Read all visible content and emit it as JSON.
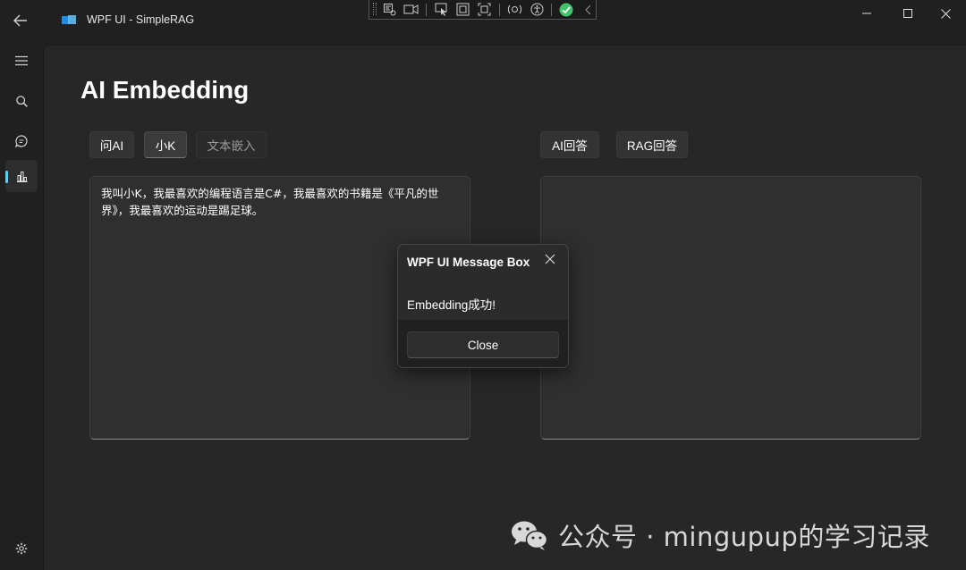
{
  "window": {
    "title": "WPF UI - SimpleRAG",
    "accent_color": "#60cdff"
  },
  "titlebar_icons": [
    "back-arrow-icon",
    "minimize-icon",
    "maximize-icon",
    "close-icon"
  ],
  "debug_toolbar": {
    "icons": [
      "live-visual-tree-icon",
      "record-icon",
      "select-element-icon",
      "display-layout-icon",
      "track-focus-icon",
      "hot-reload-icon",
      "accessibility-icon",
      "checkmark-status-icon",
      "collapse-chevron-icon"
    ],
    "status_color": "#3fc46a"
  },
  "sidebar": {
    "items": [
      {
        "name": "menu",
        "icon": "hamburger-icon"
      },
      {
        "name": "search",
        "icon": "search-icon"
      },
      {
        "name": "chat",
        "icon": "chat-icon"
      },
      {
        "name": "embedding",
        "icon": "chart-icon",
        "active": true
      },
      {
        "name": "settings",
        "icon": "gear-icon"
      }
    ]
  },
  "page": {
    "title": "AI Embedding",
    "left_buttons": {
      "ask_ai": "问AI",
      "xiao_k": "小K",
      "text_embed": "文本嵌入"
    },
    "right_buttons": {
      "ai_answer": "AI回答",
      "rag_answer": "RAG回答"
    },
    "input_text": "我叫小K，我最喜欢的编程语言是C#，我最喜欢的书籍是《平凡的世界》，我最喜欢的运动是踢足球。",
    "output_text": ""
  },
  "message_box": {
    "title": "WPF UI Message Box",
    "content": "Embedding成功!",
    "close_label": "Close"
  },
  "watermark": {
    "text": "公众号 · mingupup的学习记录",
    "icon": "wechat-icon"
  }
}
